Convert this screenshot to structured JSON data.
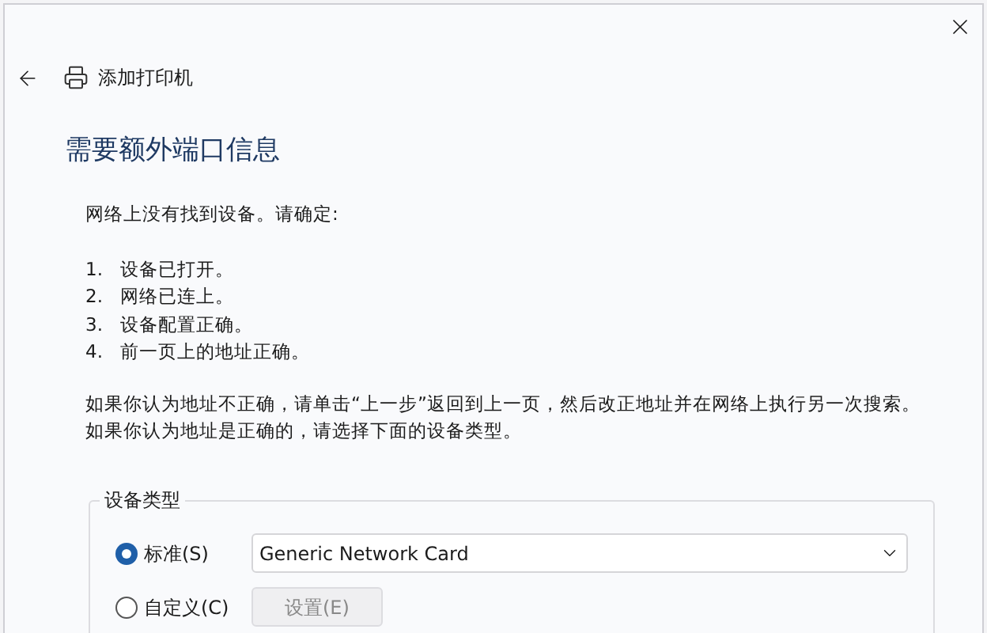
{
  "window": {
    "title": "添加打印机"
  },
  "heading": "需要额外端口信息",
  "intro": "网络上没有找到设备。请确定:",
  "checklist": [
    {
      "number": "1.",
      "text": "设备已打开。"
    },
    {
      "number": "2.",
      "text": "网络已连上。"
    },
    {
      "number": "3.",
      "text": "设备配置正确。"
    },
    {
      "number": "4.",
      "text": "前一页上的地址正确。"
    }
  ],
  "notes": [
    "如果你认为地址不正确，请单击“上一步”返回到上一页，然后改正地址并在网络上执行另一次搜索。",
    "如果你认为地址是正确的，请选择下面的设备类型。"
  ],
  "device_type": {
    "legend": "设备类型",
    "options": [
      {
        "label": "标准(S)",
        "selected": true,
        "kind": "dropdown",
        "value": "Generic Network Card"
      },
      {
        "label": "自定义(C)",
        "selected": false,
        "kind": "button",
        "button": "设置(E)"
      }
    ]
  }
}
